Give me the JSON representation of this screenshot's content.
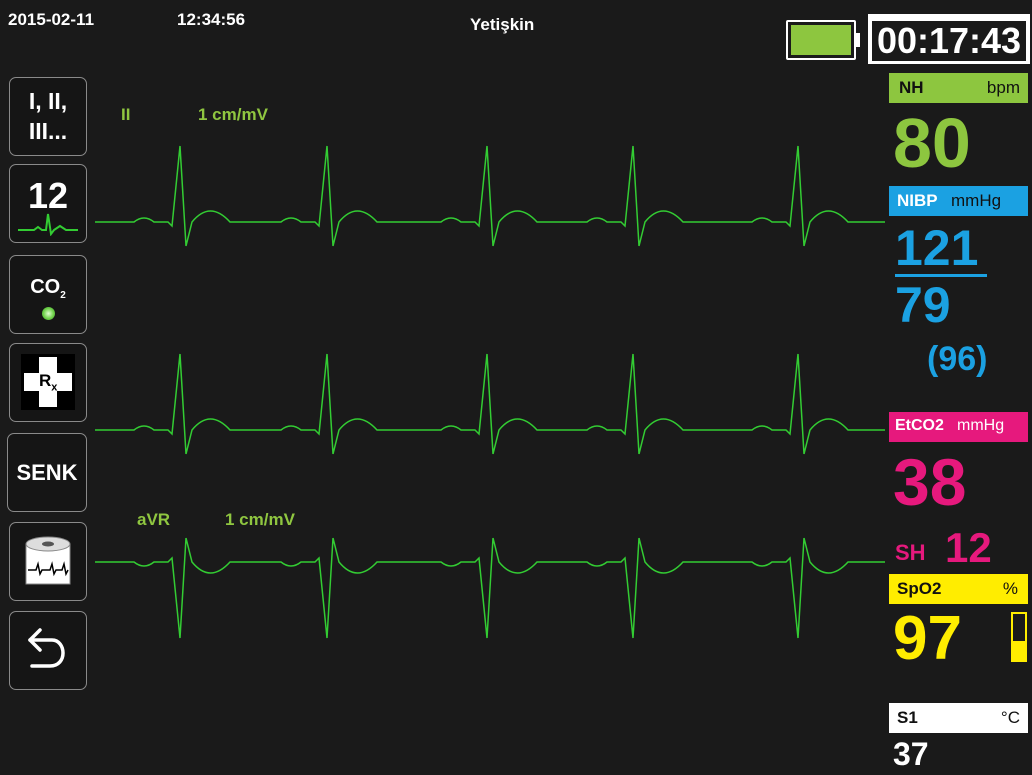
{
  "header": {
    "date": "2015-02-11",
    "time": "12:34:56",
    "patient_mode": "Yetişkin",
    "elapsed": "00:17:43",
    "battery_color": "#8dc63f"
  },
  "sidebar": {
    "leads_line1": "I, II,",
    "leads_line2": "III...",
    "twelve_lead": "12",
    "co2_label": "CO",
    "co2_sub": "2",
    "rx_label": "R",
    "rx_sub": "x",
    "sync_label": "SENK"
  },
  "waveforms": {
    "top": {
      "lead": "II",
      "gain": "1 cm/mV"
    },
    "bottom": {
      "lead": "aVR",
      "gain": "1 cm/mV"
    },
    "color": "#33cc33"
  },
  "vitals": {
    "hr": {
      "label": "NH",
      "unit": "bpm",
      "value": "80",
      "color": "#8dc63f"
    },
    "nibp": {
      "label": "NIBP",
      "unit": "mmHg",
      "systolic": "121",
      "diastolic": "79",
      "mean": "(96)",
      "color": "#1ba1e2"
    },
    "etco2": {
      "label": "EtCO2",
      "unit": "mmHg",
      "value": "38",
      "rr_label": "SH",
      "rr_value": "12",
      "color": "#e6197d"
    },
    "spo2": {
      "label": "SpO2",
      "unit": "%",
      "value": "97",
      "color": "#ffed00"
    },
    "temp": {
      "label": "S1",
      "unit": "°C",
      "value": "37",
      "color": "#ffffff"
    }
  }
}
